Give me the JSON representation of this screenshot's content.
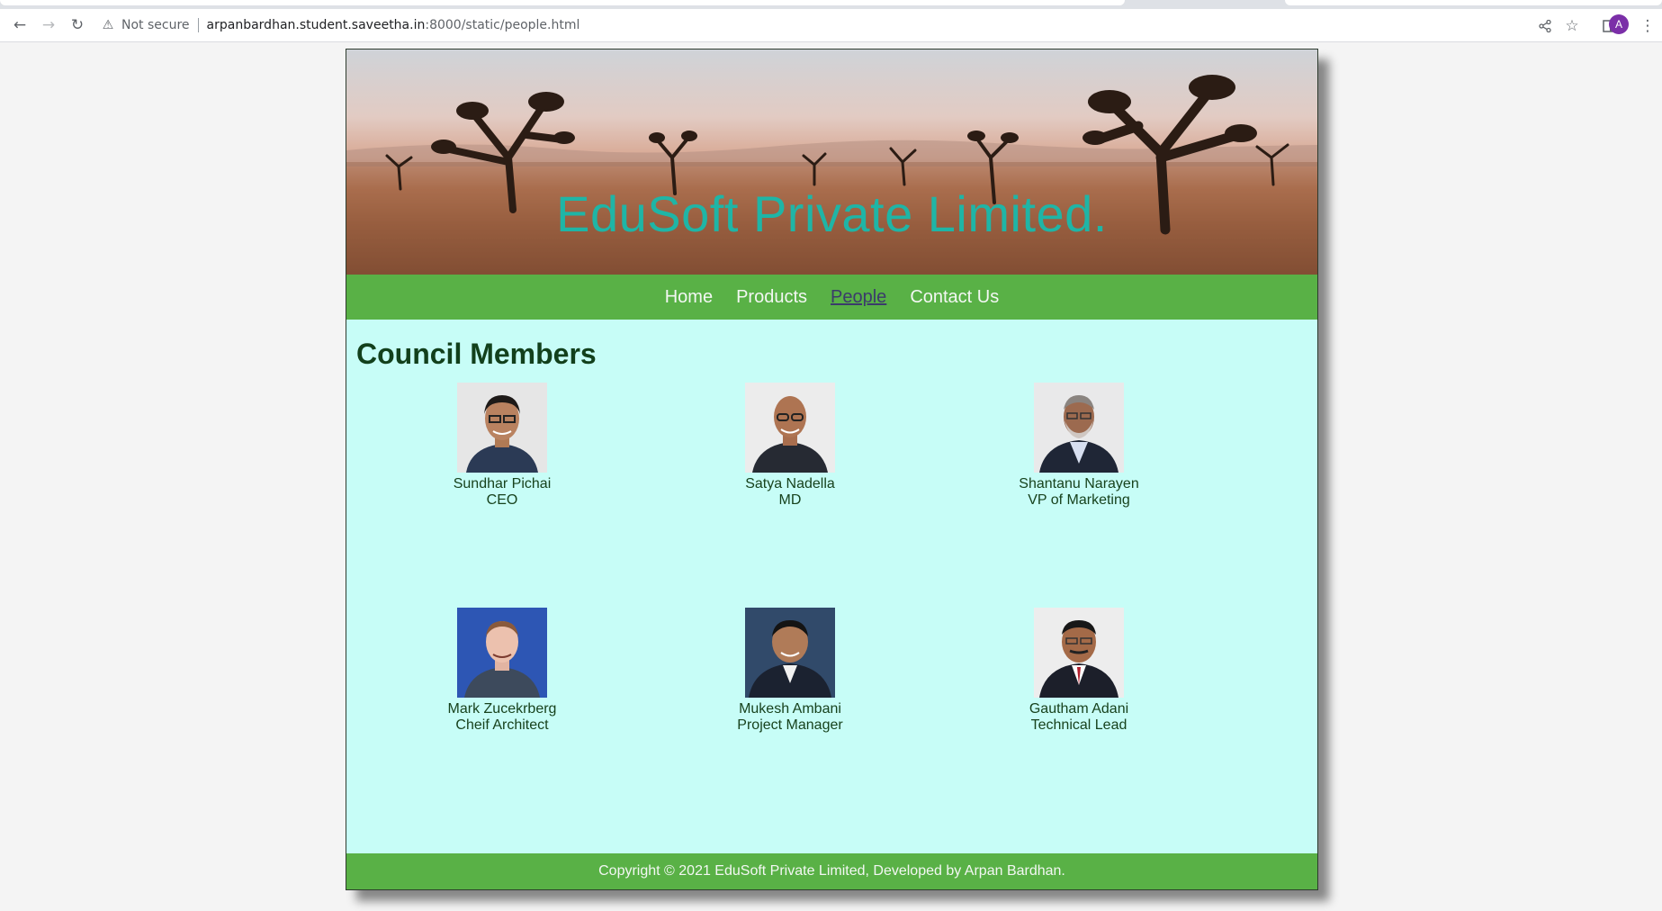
{
  "browser": {
    "security_label": "Not secure",
    "url_host": "arpanbardhan.student.saveetha.in",
    "url_rest": ":8000/static/people.html",
    "profile_initial": "A"
  },
  "site": {
    "title": "EduSoft Private Limited.",
    "nav": [
      {
        "label": "Home",
        "active": false
      },
      {
        "label": "Products",
        "active": false
      },
      {
        "label": "People",
        "active": true
      },
      {
        "label": "Contact Us",
        "active": false
      }
    ],
    "section_title": "Council Members",
    "members": [
      {
        "name": "Sundhar Pichai",
        "role": "CEO"
      },
      {
        "name": "Satya Nadella",
        "role": "MD"
      },
      {
        "name": "Shantanu Narayen",
        "role": "VP of Marketing"
      },
      {
        "name": "Mark Zucekrberg",
        "role": "Cheif Architect"
      },
      {
        "name": "Mukesh Ambani",
        "role": "Project Manager"
      },
      {
        "name": "Gautham Adani",
        "role": "Technical Lead"
      }
    ],
    "footer": "Copyright © 2021 EduSoft Private Limited, Developed by Arpan Bardhan."
  },
  "colors": {
    "title": "#1fb5a6",
    "nav_bg": "#59b146",
    "content_bg": "#c7fdf7",
    "heading": "#12401c",
    "active_link": "#3b3b6b"
  }
}
